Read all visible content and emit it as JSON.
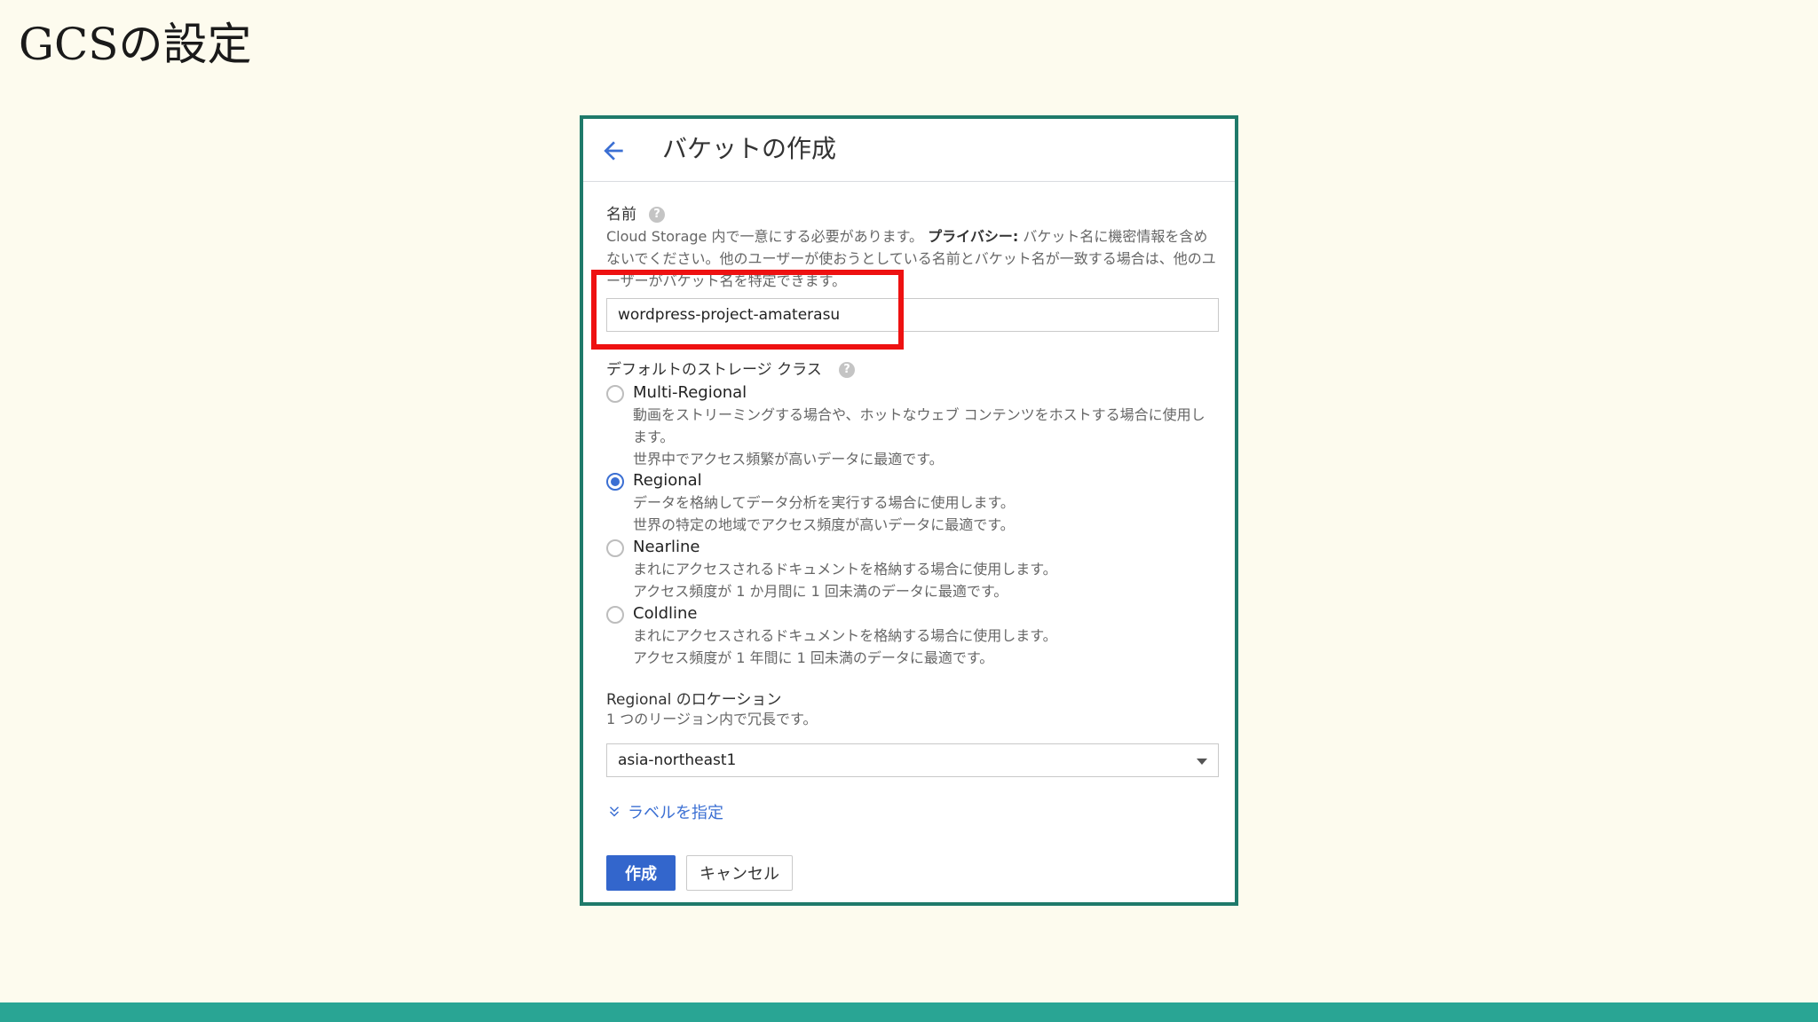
{
  "slide": {
    "title": "GCSの設定"
  },
  "panel": {
    "title": "バケットの作成",
    "name_label": "名前",
    "name_description_pre": "Cloud Storage 内で一意にする必要があります。",
    "name_description_bold": "プライバシー:",
    "name_description_post": " バケット名に機密情報を含めないでください。他のユーザーが使おうとしている名前とバケット名が一致する場合は、他のユーザーがバケット名を特定できます。",
    "name_value": "wordpress-project-amaterasu",
    "storage_class_label": "デフォルトのストレージ クラス",
    "options": [
      {
        "label": "Multi-Regional",
        "desc": "動画をストリーミングする場合や、ホットなウェブ コンテンツをホストする場合に使用します。\n世界中でアクセス頻繁が高いデータに最適です。",
        "selected": false
      },
      {
        "label": "Regional",
        "desc": "データを格納してデータ分析を実行する場合に使用します。\n世界の特定の地域でアクセス頻度が高いデータに最適です。",
        "selected": true
      },
      {
        "label": "Nearline",
        "desc": "まれにアクセスされるドキュメントを格納する場合に使用します。\nアクセス頻度が 1 か月間に 1 回未満のデータに最適です。",
        "selected": false
      },
      {
        "label": "Coldline",
        "desc": "まれにアクセスされるドキュメントを格納する場合に使用します。\nアクセス頻度が 1 年間に 1 回未満のデータに最適です。",
        "selected": false
      }
    ],
    "location_label": "Regional のロケーション",
    "location_desc": "1 つのリージョン内で冗長です。",
    "location_value": "asia-northeast1",
    "labels_link": "ラベルを指定",
    "create_button": "作成",
    "cancel_button": "キャンセル",
    "help_glyph": "?"
  },
  "colors": {
    "accent": "#3366cc",
    "highlight": "#ee1111",
    "panel_border": "#1f7a6a",
    "bottom_bar": "#29a594",
    "background": "#fdfbee"
  }
}
